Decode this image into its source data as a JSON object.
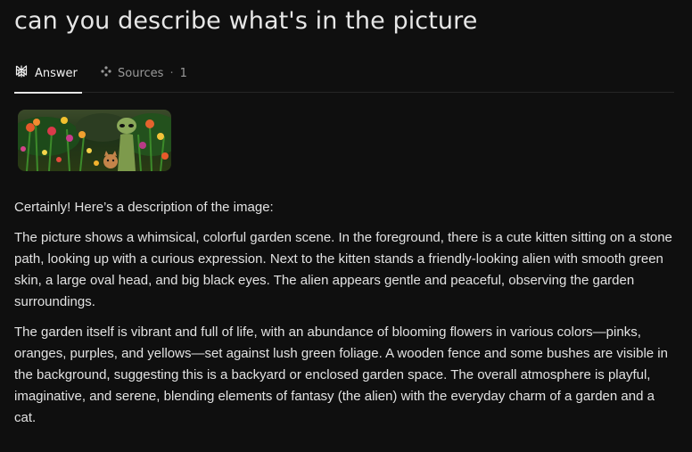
{
  "query": {
    "title": "can you describe what's in the picture"
  },
  "tabs": {
    "answer": {
      "label": "Answer",
      "icon": "perplexity-logo-icon"
    },
    "sources": {
      "label": "Sources",
      "separator": "·",
      "count": "1",
      "icon": "sources-icon"
    }
  },
  "attachment": {
    "icon": "garden-image-thumbnail"
  },
  "answer": {
    "intro": "Certainly! Here’s a description of the image:",
    "paragraph_1": "The picture shows a whimsical, colorful garden scene. In the foreground, there is a cute kitten sitting on a stone path, looking up with a curious expression. Next to the kitten stands a friendly-looking alien with smooth green skin, a large oval head, and big black eyes. The alien appears gentle and peaceful, observing the garden surroundings.",
    "paragraph_2": "The garden itself is vibrant and full of life, with an abundance of blooming flowers in various colors—pinks, oranges, purples, and yellows—set against lush green foliage. A wooden fence and some bushes are visible in the background, suggesting this is a backyard or enclosed garden space. The overall atmosphere is playful, imaginative, and serene, blending elements of fantasy (the alien) with the everyday charm of a garden and a cat."
  },
  "colors": {
    "background": "#0f0f0f",
    "text": "#e2e2e2",
    "muted": "#9a9a9a",
    "divider": "#262626"
  }
}
